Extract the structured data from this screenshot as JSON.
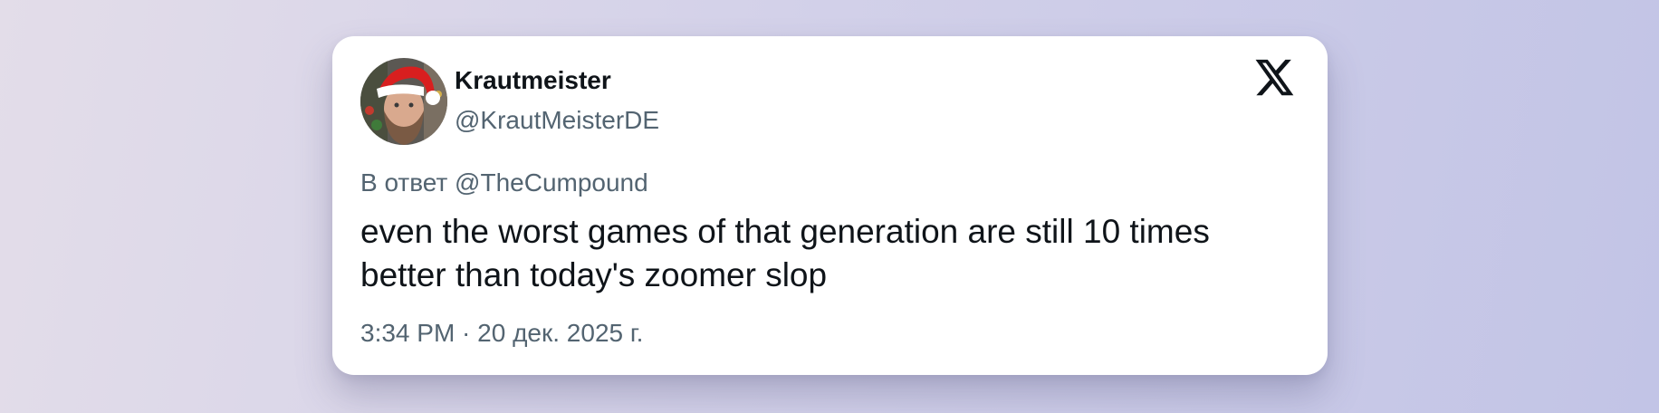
{
  "author": {
    "display_name": "Krautmeister",
    "handle": "@KrautMeisterDE",
    "avatar_icon": "profile-photo-santa-hat"
  },
  "platform": {
    "logo_icon": "x-logo-icon"
  },
  "reply": {
    "prefix": "В ответ",
    "target": "@TheCumpound"
  },
  "tweet": {
    "text": "even the worst games of that generation are still 10 times better than today's zoomer slop",
    "timestamp": "3:34 PM · 20 дек. 2025 г."
  },
  "colors": {
    "background_start": "#e3dde9",
    "background_end": "#c2c4e6",
    "card": "#ffffff",
    "primary_text": "#0f1419",
    "secondary_text": "#536471"
  }
}
